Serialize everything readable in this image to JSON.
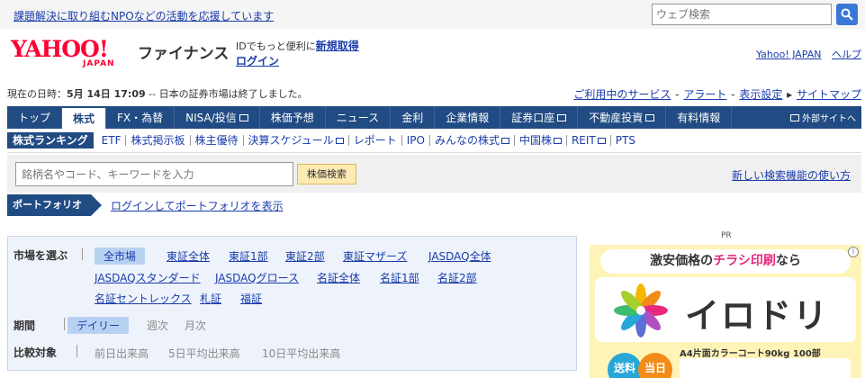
{
  "promo": {
    "text": "課題解決に取り組むNPOなどの活動を応援しています"
  },
  "search": {
    "placeholder": "ウェブ検索"
  },
  "header": {
    "logo_main": "YAHOO!",
    "logo_sub": "JAPAN",
    "brand": "ファイナンス",
    "id_text": "IDでもっと便利に",
    "id_register": "新規取得",
    "login": "ログイン",
    "links": [
      "Yahoo! JAPAN",
      "ヘルプ"
    ]
  },
  "status": {
    "prefix": "現在の日時：",
    "datetime": "5月 14日 17:09",
    "suffix": " -- 日本の証券市場は終了しました。",
    "links": [
      "ご利用中のサービス",
      "アラート",
      "表示設定",
      "サイトマップ"
    ]
  },
  "mainnav": {
    "tabs": [
      {
        "label": "トップ",
        "ext": false
      },
      {
        "label": "株式",
        "ext": false,
        "active": true
      },
      {
        "label": "FX・為替",
        "ext": false
      },
      {
        "label": "NISA/投信",
        "ext": true
      },
      {
        "label": "株価予想",
        "ext": false
      },
      {
        "label": "ニュース",
        "ext": false
      },
      {
        "label": "金利",
        "ext": false
      },
      {
        "label": "企業情報",
        "ext": false
      },
      {
        "label": "証券口座",
        "ext": true
      },
      {
        "label": "不動産投資",
        "ext": true
      },
      {
        "label": "有料情報",
        "ext": false
      }
    ],
    "outside": "外部サイトへ"
  },
  "subnav": {
    "items": [
      {
        "label": "株式ランキング",
        "active": true
      },
      {
        "label": "ETF"
      },
      {
        "label": "株式掲示板"
      },
      {
        "label": "株主優待"
      },
      {
        "label": "決算スケジュール",
        "ext": true
      },
      {
        "label": "レポート"
      },
      {
        "label": "IPO"
      },
      {
        "label": "みんなの株式",
        "ext": true
      },
      {
        "label": "中国株",
        "ext": true
      },
      {
        "label": "REIT",
        "ext": true
      },
      {
        "label": "PTS"
      }
    ]
  },
  "stocksearch": {
    "placeholder": "銘柄名やコード、キーワードを入力",
    "button": "株価検索",
    "new_link": "新しい検索機能の使い方"
  },
  "portfolio": {
    "tag": "ポートフォリオ",
    "link": "ログインしてポートフォリオを表示"
  },
  "ranking": {
    "market_label": "市場を選ぶ",
    "markets_row1": [
      "全市場",
      "東証全体",
      "東証1部",
      "東証2部",
      "東証マザーズ",
      "JASDAQ全体"
    ],
    "markets_row2": [
      "JASDAQスタンダード",
      "JASDAQグロース",
      "名証全体",
      "名証1部",
      "名証2部"
    ],
    "markets_row3": [
      "名証セントレックス",
      "札証",
      "福証"
    ],
    "period_label": "期間",
    "periods": [
      "デイリー",
      "週次",
      "月次"
    ],
    "compare_label": "比較対象",
    "compares": [
      "前日出来高",
      "5日平均出来高",
      "10日平均出来高"
    ]
  },
  "ad": {
    "pr": "PR",
    "headline_a": "激安価格の",
    "headline_b": "チラシ印刷",
    "headline_c": "なら",
    "brand": "イロドリ",
    "info": "A4片面カラーコート90kg 100部",
    "badge1": "送料",
    "badge2": "当日"
  }
}
